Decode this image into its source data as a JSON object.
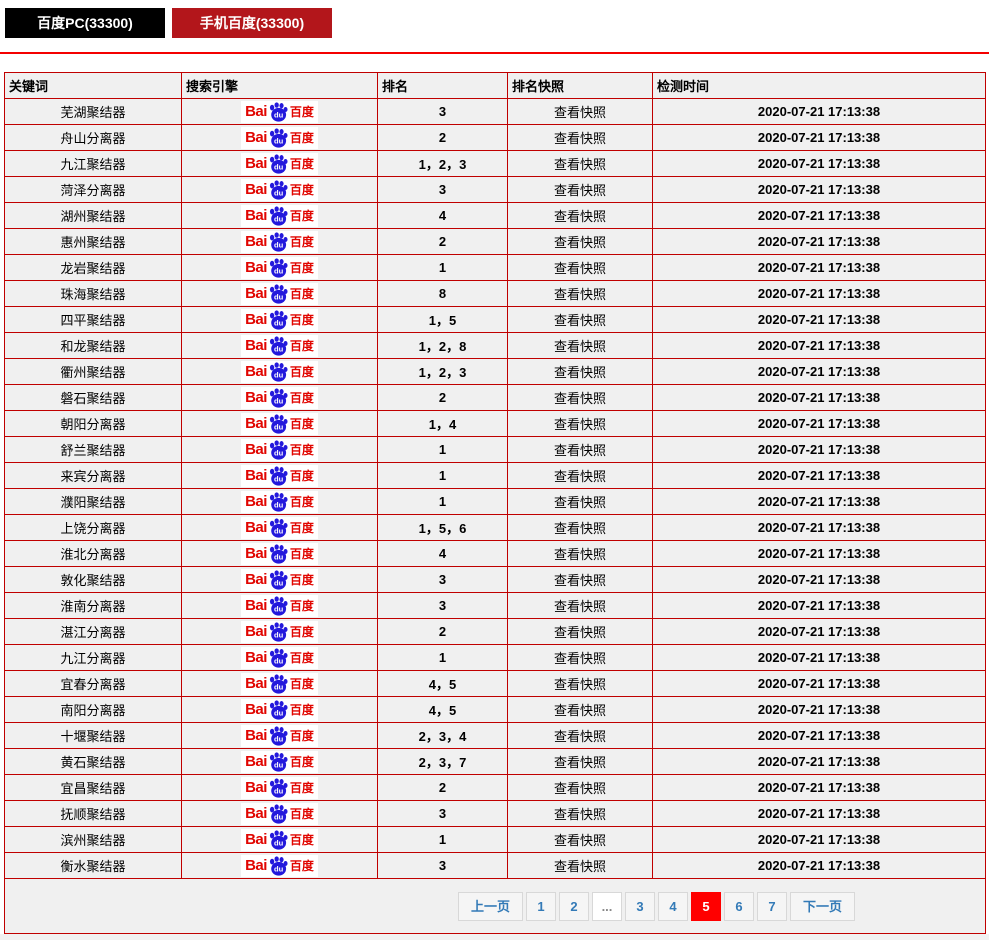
{
  "tabs": [
    {
      "label": "百度PC(33300)",
      "active": false
    },
    {
      "label": "手机百度(33300)",
      "active": true
    }
  ],
  "logo": {
    "bai": "Bai",
    "du": "du",
    "cn": "百度",
    "engine": "baidu"
  },
  "table": {
    "headers": [
      "关键词",
      "搜索引擎",
      "排名",
      "排名快照",
      "检测时间"
    ],
    "rows": [
      {
        "keyword": "芜湖聚结器",
        "rank": "3",
        "snapshot": "查看快照",
        "time": "2020-07-21 17:13:38"
      },
      {
        "keyword": "舟山分离器",
        "rank": "2",
        "snapshot": "查看快照",
        "time": "2020-07-21 17:13:38"
      },
      {
        "keyword": "九江聚结器",
        "rank": "1，2，3",
        "snapshot": "查看快照",
        "time": "2020-07-21 17:13:38"
      },
      {
        "keyword": "菏泽分离器",
        "rank": "3",
        "snapshot": "查看快照",
        "time": "2020-07-21 17:13:38"
      },
      {
        "keyword": "湖州聚结器",
        "rank": "4",
        "snapshot": "查看快照",
        "time": "2020-07-21 17:13:38"
      },
      {
        "keyword": "惠州聚结器",
        "rank": "2",
        "snapshot": "查看快照",
        "time": "2020-07-21 17:13:38"
      },
      {
        "keyword": "龙岩聚结器",
        "rank": "1",
        "snapshot": "查看快照",
        "time": "2020-07-21 17:13:38"
      },
      {
        "keyword": "珠海聚结器",
        "rank": "8",
        "snapshot": "查看快照",
        "time": "2020-07-21 17:13:38"
      },
      {
        "keyword": "四平聚结器",
        "rank": "1，5",
        "snapshot": "查看快照",
        "time": "2020-07-21 17:13:38"
      },
      {
        "keyword": "和龙聚结器",
        "rank": "1，2，8",
        "snapshot": "查看快照",
        "time": "2020-07-21 17:13:38"
      },
      {
        "keyword": "衢州聚结器",
        "rank": "1，2，3",
        "snapshot": "查看快照",
        "time": "2020-07-21 17:13:38"
      },
      {
        "keyword": "磐石聚结器",
        "rank": "2",
        "snapshot": "查看快照",
        "time": "2020-07-21 17:13:38"
      },
      {
        "keyword": "朝阳分离器",
        "rank": "1，4",
        "snapshot": "查看快照",
        "time": "2020-07-21 17:13:38"
      },
      {
        "keyword": "舒兰聚结器",
        "rank": "1",
        "snapshot": "查看快照",
        "time": "2020-07-21 17:13:38"
      },
      {
        "keyword": "来宾分离器",
        "rank": "1",
        "snapshot": "查看快照",
        "time": "2020-07-21 17:13:38"
      },
      {
        "keyword": "濮阳聚结器",
        "rank": "1",
        "snapshot": "查看快照",
        "time": "2020-07-21 17:13:38"
      },
      {
        "keyword": "上饶分离器",
        "rank": "1，5，6",
        "snapshot": "查看快照",
        "time": "2020-07-21 17:13:38"
      },
      {
        "keyword": "淮北分离器",
        "rank": "4",
        "snapshot": "查看快照",
        "time": "2020-07-21 17:13:38"
      },
      {
        "keyword": "敦化聚结器",
        "rank": "3",
        "snapshot": "查看快照",
        "time": "2020-07-21 17:13:38"
      },
      {
        "keyword": "淮南分离器",
        "rank": "3",
        "snapshot": "查看快照",
        "time": "2020-07-21 17:13:38"
      },
      {
        "keyword": "湛江分离器",
        "rank": "2",
        "snapshot": "查看快照",
        "time": "2020-07-21 17:13:38"
      },
      {
        "keyword": "九江分离器",
        "rank": "1",
        "snapshot": "查看快照",
        "time": "2020-07-21 17:13:38"
      },
      {
        "keyword": "宜春分离器",
        "rank": "4，5",
        "snapshot": "查看快照",
        "time": "2020-07-21 17:13:38"
      },
      {
        "keyword": "南阳分离器",
        "rank": "4，5",
        "snapshot": "查看快照",
        "time": "2020-07-21 17:13:38"
      },
      {
        "keyword": "十堰聚结器",
        "rank": "2，3，4",
        "snapshot": "查看快照",
        "time": "2020-07-21 17:13:38"
      },
      {
        "keyword": "黄石聚结器",
        "rank": "2，3，7",
        "snapshot": "查看快照",
        "time": "2020-07-21 17:13:38"
      },
      {
        "keyword": "宜昌聚结器",
        "rank": "2",
        "snapshot": "查看快照",
        "time": "2020-07-21 17:13:38"
      },
      {
        "keyword": "抚顺聚结器",
        "rank": "3",
        "snapshot": "查看快照",
        "time": "2020-07-21 17:13:38"
      },
      {
        "keyword": "滨州聚结器",
        "rank": "1",
        "snapshot": "查看快照",
        "time": "2020-07-21 17:13:38"
      },
      {
        "keyword": "衡水聚结器",
        "rank": "3",
        "snapshot": "查看快照",
        "time": "2020-07-21 17:13:38"
      }
    ]
  },
  "pagination": {
    "items": [
      {
        "label": "上一页",
        "type": "prev"
      },
      {
        "label": "1"
      },
      {
        "label": "2"
      },
      {
        "label": "...",
        "type": "ellipsis"
      },
      {
        "label": "3"
      },
      {
        "label": "4"
      },
      {
        "label": "5",
        "active": true
      },
      {
        "label": "6"
      },
      {
        "label": "7"
      },
      {
        "label": "下一页",
        "type": "next"
      }
    ],
    "active_page": "5"
  },
  "colors": {
    "tab_active_red": "#b3161b",
    "tab_inactive_black": "#000000",
    "divider_red": "#f40000",
    "table_border_red": "#c00000",
    "cell_bg": "#f0f0f0",
    "pagination_blue": "#337ab7",
    "active_page_bg": "#ff0000",
    "baidu_red": "#e10601",
    "baidu_blue": "#2319dc"
  }
}
